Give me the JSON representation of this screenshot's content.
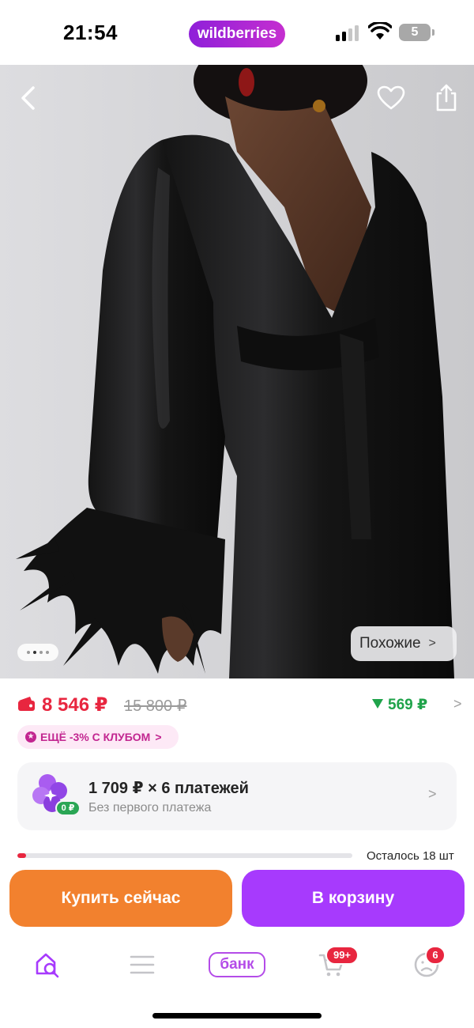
{
  "status_bar": {
    "time": "21:54",
    "logo": "wildberries",
    "battery": "5"
  },
  "product": {
    "similar_label": "Похожие",
    "price_now": "8 546 ₽",
    "price_old": "15 800 ₽",
    "cashback": "569 ₽",
    "club_offer": "ЕЩЁ -3% С КЛУБОМ",
    "photo_count": 4,
    "photo_index": 2
  },
  "installment": {
    "title": "1 709 ₽ × 6 платежей",
    "subtitle": "Без первого платежа",
    "badge": "0 ₽"
  },
  "stock": {
    "label": "Осталось 18 шт",
    "fill_fraction": 0.025
  },
  "actions": {
    "buy_now": "Купить сейчас",
    "add_to_cart": "В корзину"
  },
  "nav": {
    "bank_label": "банк",
    "cart_badge": "99+",
    "profile_badge": "6"
  },
  "colors": {
    "brand": "#a73afd",
    "buy_now": "#f2812e",
    "price": "#e8263f",
    "cashback": "#1fa34a"
  }
}
